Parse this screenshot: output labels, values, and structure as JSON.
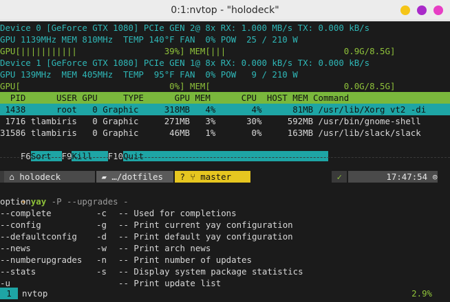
{
  "window": {
    "title": "0:1:nvtop - \"holodeck\""
  },
  "gpu0": {
    "line1": "Device 0 [GeForce GTX 1080] PCIe GEN 2@ 8x RX: 1.000 MB/s TX: 0.000 kB/s",
    "line2": "GPU 1139MHz MEM 810MHz  TEMP 140°F FAN  0% POW  25 / 210 W",
    "bar": "GPU[|||||||||||                 39%] MEM[|||                       0.9G/8.5G]"
  },
  "gpu1": {
    "line1": "Device 1 [GeForce GTX 1080] PCIe GEN 1@ 8x RX: 0.000 kB/s TX: 0.000 kB/s",
    "line2": "GPU 139MHz  MEM 405MHz  TEMP  95°F FAN  0% POW   9 / 210 W",
    "bar": "GPU[                             0%] MEM[                          0.0G/8.5G]"
  },
  "process_table": {
    "header": "  PID      USER GPU     TYPE      GPU MEM      CPU  HOST MEM Command",
    "rows": [
      " 1438      root   0 Graphic     318MB   4%       4%      81MB /usr/lib/Xorg vt2 -di",
      " 1716 tlambiris   0 Graphic     271MB   3%      30%     592MB /usr/bin/gnome-shell",
      "31586 tlambiris   0 Graphic      46MB   1%       0%     163MB /usr/lib/slack/slack"
    ]
  },
  "function_keys": [
    {
      "key": "F6",
      "label": "Sort  "
    },
    {
      "key": "F9",
      "label": "Kill   "
    },
    {
      "key": "F10",
      "label": "Quit                                    "
    }
  ],
  "prompt": {
    "user_segment": " ⌂ holodeck ",
    "dir_segment": " ▰ …/dotfiles ",
    "git_segment": " ? ⑂ master ",
    "status_segment": " ✓ ",
    "time_segment": " 17:47:54 ⊙",
    "arrow": "➜",
    "command": "yay",
    "args": "-P --upgrades -"
  },
  "output": {
    "heading": "option",
    "lines": [
      {
        "long": "--complete",
        "short": "-c",
        "desc": "-- Used for completions"
      },
      {
        "long": "--config",
        "short": "-g",
        "desc": "-- Print current yay configuration"
      },
      {
        "long": "--defaultconfig",
        "short": "-d",
        "desc": "-- Print default yay configuration"
      },
      {
        "long": "--news",
        "short": "-w",
        "desc": "-- Print arch news"
      },
      {
        "long": "--numberupgrades",
        "short": "-n",
        "desc": "-- Print number of updates"
      },
      {
        "long": "--stats",
        "short": "-s",
        "desc": "-- Display system package statistics"
      },
      {
        "long": "-u",
        "short": "",
        "desc": "-- Print update list"
      }
    ]
  },
  "tmux": {
    "window_index": "1",
    "window_name": "nvtop",
    "right": "2.9%"
  },
  "colors": {
    "accent_teal": "#1ea5a5",
    "accent_green": "#7ab83c",
    "accent_yellow": "#e6c620"
  }
}
